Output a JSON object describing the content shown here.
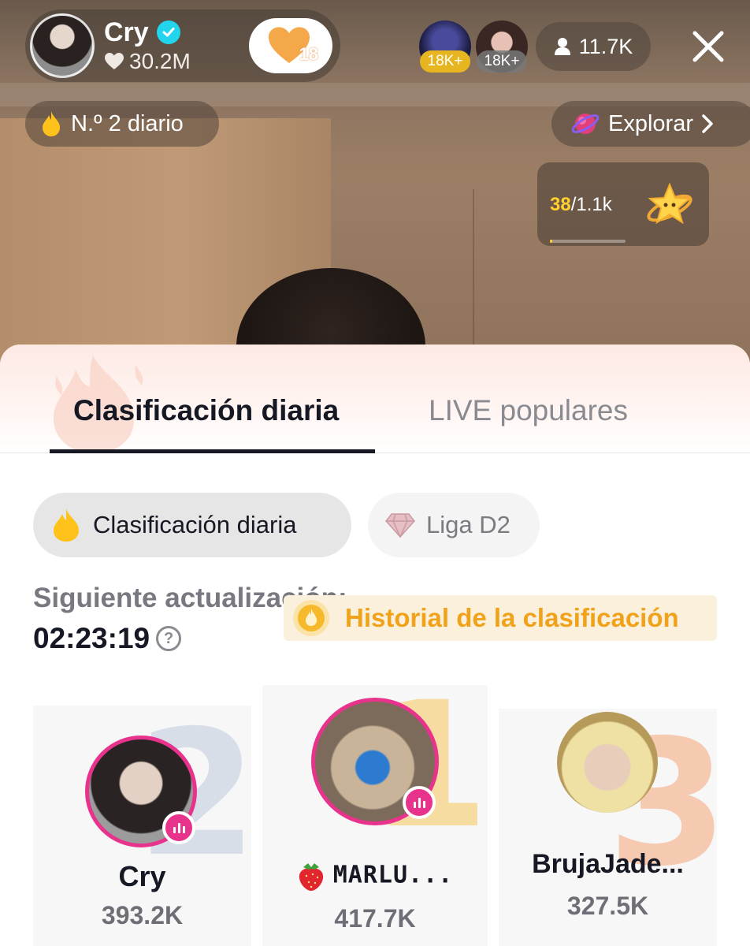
{
  "host": {
    "name": "Cry",
    "likes": "30.2M",
    "follow_badge_count": "18"
  },
  "top_viewers": [
    {
      "badge": "18K+"
    },
    {
      "badge": "18K+"
    }
  ],
  "viewer_count": "11.7K",
  "rank_pill": {
    "label": "N.º 2 diario"
  },
  "explore": {
    "label": "Explorar"
  },
  "goal": {
    "current": "38",
    "target": "/1.1k",
    "progress": 0.035
  },
  "sheet": {
    "tabs": [
      {
        "label": "Clasificación diaria",
        "active": true
      },
      {
        "label": "LIVE populares",
        "active": false
      }
    ],
    "chips": [
      {
        "label": "Clasificación diaria",
        "selected": true
      },
      {
        "label": "Liga D2",
        "selected": false
      }
    ],
    "next_update_label": "Siguiente actualización:",
    "countdown": "02:23:19",
    "help_symbol": "?",
    "history_label": "Historial de la clasificación",
    "podium": [
      {
        "rank": "2",
        "name": "Cry",
        "score": "393.2K",
        "live": true
      },
      {
        "rank": "1",
        "name": "MARLU...",
        "score": "417.7K",
        "live": true
      },
      {
        "rank": "3",
        "name": "BrujaJade...",
        "score": "327.5K",
        "live": false
      }
    ]
  },
  "colors": {
    "accent_pink": "#e8338c",
    "gold": "#f0a31a",
    "verified": "#20d5ec"
  },
  "icons": [
    "verified-icon",
    "heart-icon",
    "person-icon",
    "close-icon",
    "flame-icon",
    "planet-icon",
    "chevron-right-icon",
    "star-icon",
    "diamond-icon",
    "help-icon",
    "strawberry-icon",
    "live-icon"
  ]
}
